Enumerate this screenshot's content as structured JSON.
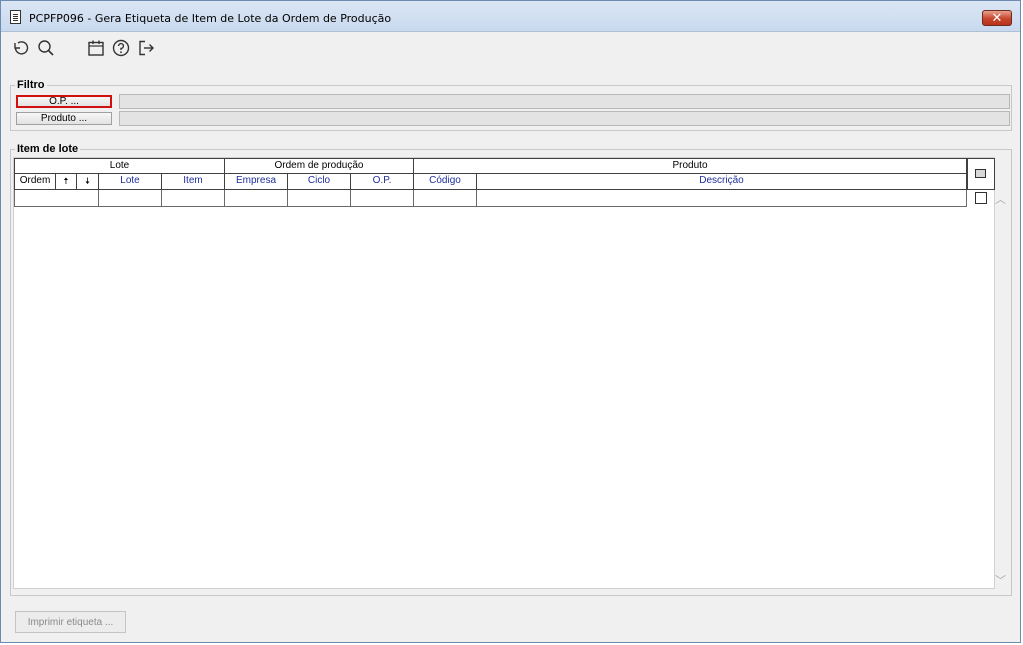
{
  "window": {
    "title": "PCPFP096 - Gera Etiqueta de Item de Lote da Ordem de Produção",
    "close_label": "✕"
  },
  "toolbar": {
    "icons": [
      "undo-icon",
      "search-icon",
      "calendar-icon",
      "help-icon",
      "exit-icon"
    ]
  },
  "filtro": {
    "label": "Filtro",
    "op_button": "O.P. ...",
    "produto_button": "Produto ..."
  },
  "item_lote": {
    "label": "Item de lote",
    "groups": {
      "lote": "Lote",
      "ordem": "Ordem de produção",
      "produto": "Produto"
    },
    "columns": {
      "ordem": "Ordem",
      "up": "🠅",
      "down": "🠇",
      "lote": "Lote",
      "item": "Item",
      "empresa": "Empresa",
      "ciclo": "Ciclo",
      "op": "O.P.",
      "codigo": "Código",
      "descricao": "Descrição"
    }
  },
  "footer": {
    "print_button": "Imprimir etiqueta ..."
  }
}
